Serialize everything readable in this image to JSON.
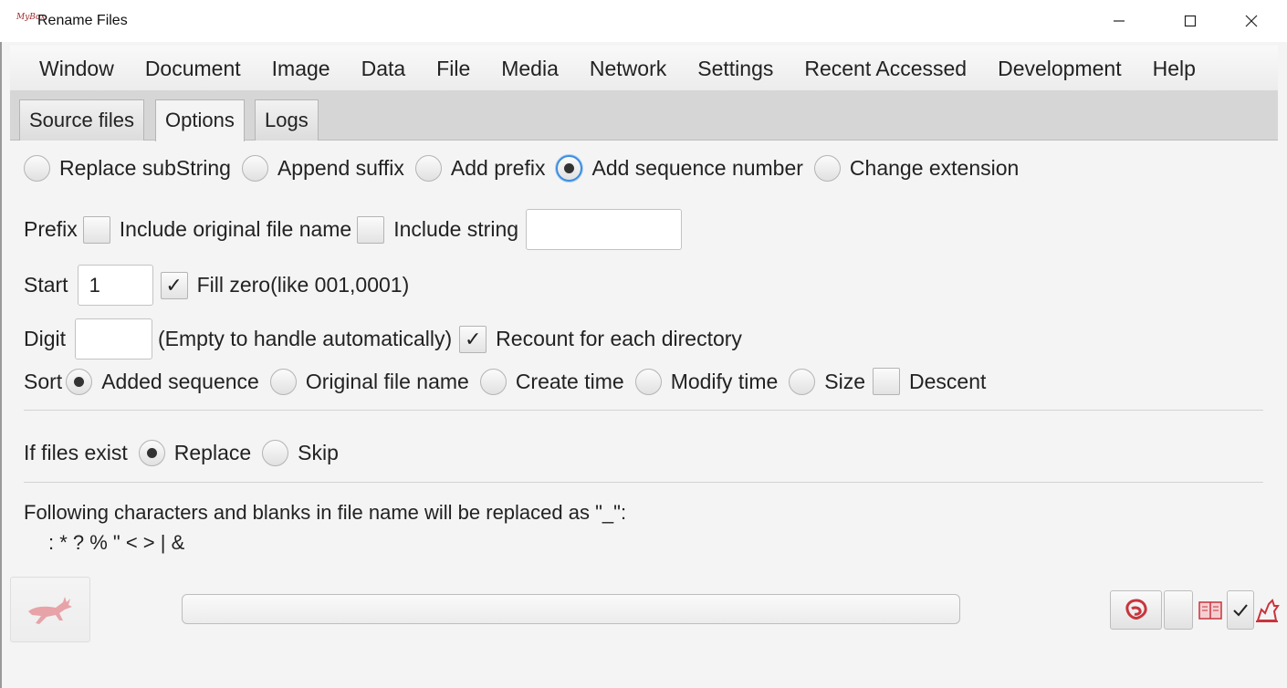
{
  "window": {
    "logo_text": "MyBox",
    "title": "Rename Files"
  },
  "menu": [
    "Window",
    "Document",
    "Image",
    "Data",
    "File",
    "Media",
    "Network",
    "Settings",
    "Recent Accessed",
    "Development",
    "Help"
  ],
  "tabs": [
    "Source files",
    "Options",
    "Logs"
  ],
  "active_tab": "Options",
  "rename_modes": {
    "options": [
      "Replace subString",
      "Append suffix",
      "Add prefix",
      "Add sequence number",
      "Change extension"
    ],
    "selected": "Add sequence number"
  },
  "prefix_row": {
    "label": "Prefix",
    "include_original_label": "Include original file name",
    "include_original_checked": false,
    "include_string_label": "Include string",
    "include_string_checked": false,
    "include_string_value": ""
  },
  "start_row": {
    "label": "Start",
    "value": "1",
    "fill_zero_label": "Fill zero(like 001,0001)",
    "fill_zero_checked": true,
    "check_mark": "✓"
  },
  "digit_row": {
    "label": "Digit",
    "value": "",
    "hint": "(Empty to handle automatically)",
    "recount_label": "Recount for each directory",
    "recount_checked": true,
    "check_mark": "✓"
  },
  "sort_row": {
    "label": "Sort",
    "options": [
      "Added sequence",
      "Original file name",
      "Create time",
      "Modify time",
      "Size"
    ],
    "selected": "Added sequence",
    "descent_label": "Descent",
    "descent_checked": false
  },
  "exist_row": {
    "label": "If files exist",
    "options": [
      "Replace",
      "Skip"
    ],
    "selected": "Replace"
  },
  "notice": {
    "line1": "Following characters and blanks in file name will be replaced as \"_\":",
    "line2": ": * ? % \" < > | &"
  },
  "icons": {
    "logo": "mybox-logo-icon",
    "minimize": "minimize-icon",
    "maximize": "maximize-icon",
    "close": "close-icon",
    "start": "deer-run-icon",
    "weibo": "weibo-icon",
    "manual": "book-icon",
    "confirm": "check-icon",
    "cat": "cat-icon"
  },
  "colors": {
    "accent_red": "#c8343c",
    "focus_blue": "#3c8ce0"
  }
}
